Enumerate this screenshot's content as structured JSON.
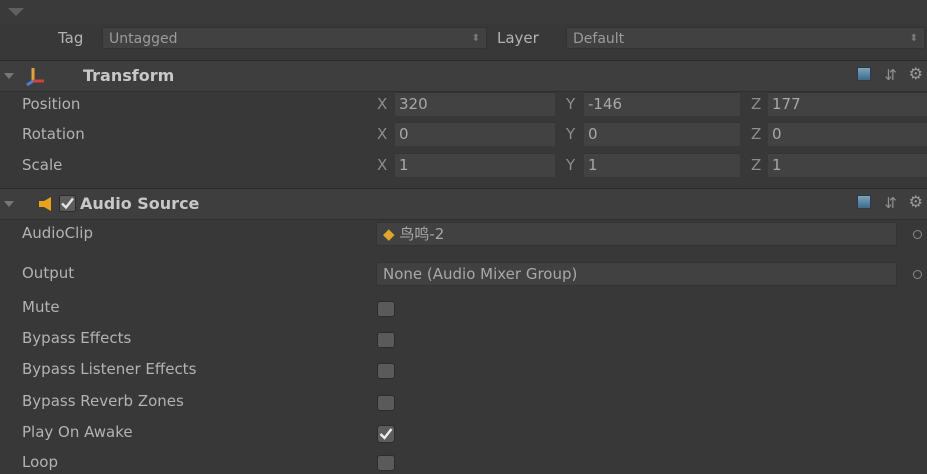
{
  "top": {
    "tag_label": "Tag",
    "tag_value": "Untagged",
    "layer_label": "Layer",
    "layer_value": "Default"
  },
  "transform": {
    "title": "Transform",
    "rows": [
      {
        "label": "Position",
        "x": "320",
        "y": "-146",
        "z": "177"
      },
      {
        "label": "Rotation",
        "x": "0",
        "y": "0",
        "z": "0"
      },
      {
        "label": "Scale",
        "x": "1",
        "y": "1",
        "z": "1"
      }
    ],
    "axis": {
      "x": "X",
      "y": "Y",
      "z": "Z"
    }
  },
  "audio": {
    "title": "Audio Source",
    "enabled": true,
    "clip_label": "AudioClip",
    "clip_value": "鸟鸣-2",
    "output_label": "Output",
    "output_value": "None (Audio Mixer Group)",
    "toggles": [
      {
        "label": "Mute",
        "checked": false
      },
      {
        "label": "Bypass Effects",
        "checked": false
      },
      {
        "label": "Bypass Listener Effects",
        "checked": false
      },
      {
        "label": "Bypass Reverb Zones",
        "checked": false
      },
      {
        "label": "Play On Awake",
        "checked": true
      },
      {
        "label": "Loop",
        "checked": false
      }
    ]
  },
  "icons": {
    "help": "help-icon",
    "presets": "preset-icon",
    "settings": "gear-icon",
    "transform": "transform-icon",
    "audio": "speaker-icon",
    "object_picker": "object-picker-icon"
  },
  "colors": {
    "background": "#383838",
    "header": "#3e3e3e",
    "field": "#414141",
    "speaker": "#e8a21c"
  }
}
